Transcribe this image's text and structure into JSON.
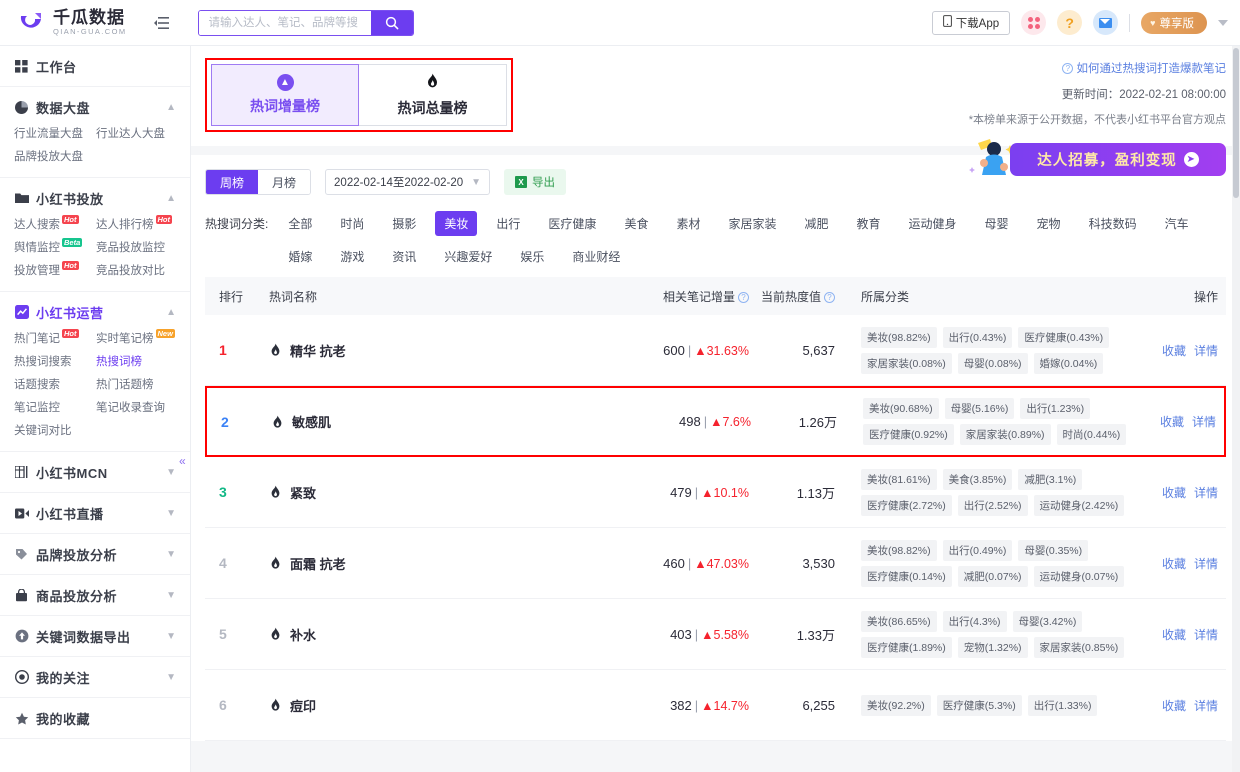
{
  "header": {
    "logo_cn": "千瓜数据",
    "logo_en": "QIAN-GUA.COM",
    "collapse_icon": "menu-fold-icon",
    "search": {
      "placeholder": "请输入达人、笔记、品牌等搜",
      "value": "",
      "button_icon": "search-icon"
    },
    "download_app": "下载App",
    "icons": {
      "apps": "apps-grid-icon",
      "help": "question-mark-icon",
      "message": "envelope-icon"
    },
    "vip_label": "尊享版",
    "user_caret": "caret-down-icon"
  },
  "sidebar": {
    "workbench": {
      "label": "工作台",
      "icon": "grid-icon"
    },
    "groups": [
      {
        "label": "数据大盘",
        "icon": "pie-chart-icon",
        "expanded": true,
        "active": false,
        "links": [
          {
            "label": "行业流量大盘",
            "badge": ""
          },
          {
            "label": "行业达人大盘",
            "badge": ""
          },
          {
            "label": "品牌投放大盘",
            "badge": ""
          }
        ]
      },
      {
        "label": "小红书投放",
        "icon": "folder-icon",
        "expanded": true,
        "active": false,
        "links": [
          {
            "label": "达人搜索",
            "badge": "Hot"
          },
          {
            "label": "达人排行榜",
            "badge": "Hot"
          },
          {
            "label": "舆情监控",
            "badge": "Beta"
          },
          {
            "label": "竞品投放监控",
            "badge": ""
          },
          {
            "label": "投放管理",
            "badge": "Hot"
          },
          {
            "label": "竞品投放对比",
            "badge": ""
          }
        ]
      },
      {
        "label": "小红书运营",
        "icon": "chart-line-icon",
        "expanded": true,
        "active": true,
        "links": [
          {
            "label": "热门笔记",
            "badge": "Hot"
          },
          {
            "label": "实时笔记榜",
            "badge": "New"
          },
          {
            "label": "热搜词搜索",
            "badge": ""
          },
          {
            "label": "热搜词榜",
            "badge": "",
            "current": true
          },
          {
            "label": "话题搜索",
            "badge": ""
          },
          {
            "label": "热门话题榜",
            "badge": ""
          },
          {
            "label": "笔记监控",
            "badge": ""
          },
          {
            "label": "笔记收录查询",
            "badge": ""
          },
          {
            "label": "关键词对比",
            "badge": ""
          }
        ]
      },
      {
        "label": "小红书MCN",
        "icon": "table-icon",
        "expanded": false,
        "links": []
      },
      {
        "label": "小红书直播",
        "icon": "video-icon",
        "expanded": false,
        "links": []
      },
      {
        "label": "品牌投放分析",
        "icon": "tag-icon",
        "expanded": false,
        "links": []
      },
      {
        "label": "商品投放分析",
        "icon": "bag-icon",
        "expanded": false,
        "links": []
      },
      {
        "label": "关键词数据导出",
        "icon": "upload-circle-icon",
        "expanded": false,
        "links": []
      },
      {
        "label": "我的关注",
        "icon": "eye-icon",
        "expanded": false,
        "links": []
      },
      {
        "label": "我的收藏",
        "icon": "star-icon",
        "expanded": false,
        "links": []
      }
    ],
    "collapse_handle": "«"
  },
  "main": {
    "tabs": [
      {
        "label": "热词增量榜",
        "icon": "arrow-up-circle-icon",
        "active": true
      },
      {
        "label": "热词总量榜",
        "icon": "flame-icon",
        "active": false
      }
    ],
    "help_link": "如何通过热搜词打造爆款笔记",
    "update_time": "更新时间：2022-02-21 08:00:00",
    "disclaimer": "*本榜单来源于公开数据，不代表小红书平台官方观点",
    "range_tabs": [
      {
        "label": "周榜",
        "active": true
      },
      {
        "label": "月榜",
        "active": false
      }
    ],
    "date_range": "2022-02-14至2022-02-20",
    "export_label": "导出",
    "promo_text": "达人招募，盈利变现",
    "category_label": "热搜词分类:",
    "categories": [
      {
        "label": "全部",
        "active": false
      },
      {
        "label": "时尚",
        "active": false
      },
      {
        "label": "摄影",
        "active": false
      },
      {
        "label": "美妆",
        "active": true
      },
      {
        "label": "出行",
        "active": false
      },
      {
        "label": "医疗健康",
        "active": false
      },
      {
        "label": "美食",
        "active": false
      },
      {
        "label": "素材",
        "active": false
      },
      {
        "label": "家居家装",
        "active": false
      },
      {
        "label": "减肥",
        "active": false
      },
      {
        "label": "教育",
        "active": false
      },
      {
        "label": "运动健身",
        "active": false
      },
      {
        "label": "母婴",
        "active": false
      },
      {
        "label": "宠物",
        "active": false
      },
      {
        "label": "科技数码",
        "active": false
      },
      {
        "label": "汽车",
        "active": false
      },
      {
        "label": "婚嫁",
        "active": false
      },
      {
        "label": "游戏",
        "active": false
      },
      {
        "label": "资讯",
        "active": false
      },
      {
        "label": "兴趣爱好",
        "active": false
      },
      {
        "label": "娱乐",
        "active": false
      },
      {
        "label": "商业财经",
        "active": false
      }
    ],
    "table": {
      "columns": {
        "rank": "排行",
        "name": "热词名称",
        "increase": "相关笔记增量",
        "heat": "当前热度值",
        "cats": "所属分类",
        "op": "操作"
      },
      "actions": {
        "favorite": "收藏",
        "detail": "详情"
      },
      "rows": [
        {
          "rank": "1",
          "keyword": "精华 抗老",
          "increase": "600",
          "change": "31.63%",
          "heat": "5,637",
          "cats": [
            "美妆(98.82%)",
            "出行(0.43%)",
            "医疗健康(0.43%)",
            "家居家装(0.08%)",
            "母婴(0.08%)",
            "婚嫁(0.04%)"
          ],
          "highlight": false
        },
        {
          "rank": "2",
          "keyword": "敏感肌",
          "increase": "498",
          "change": "7.6%",
          "heat": "1.26万",
          "cats": [
            "美妆(90.68%)",
            "母婴(5.16%)",
            "出行(1.23%)",
            "医疗健康(0.92%)",
            "家居家装(0.89%)",
            "时尚(0.44%)"
          ],
          "highlight": true
        },
        {
          "rank": "3",
          "keyword": "紧致",
          "increase": "479",
          "change": "10.1%",
          "heat": "1.13万",
          "cats": [
            "美妆(81.61%)",
            "美食(3.85%)",
            "减肥(3.1%)",
            "医疗健康(2.72%)",
            "出行(2.52%)",
            "运动健身(2.42%)"
          ],
          "highlight": false
        },
        {
          "rank": "4",
          "keyword": "面霜 抗老",
          "increase": "460",
          "change": "47.03%",
          "heat": "3,530",
          "cats": [
            "美妆(98.82%)",
            "出行(0.49%)",
            "母婴(0.35%)",
            "医疗健康(0.14%)",
            "减肥(0.07%)",
            "运动健身(0.07%)"
          ],
          "highlight": false
        },
        {
          "rank": "5",
          "keyword": "补水",
          "increase": "403",
          "change": "5.58%",
          "heat": "1.33万",
          "cats": [
            "美妆(86.65%)",
            "出行(4.3%)",
            "母婴(3.42%)",
            "医疗健康(1.89%)",
            "宠物(1.32%)",
            "家居家装(0.85%)"
          ],
          "highlight": false
        },
        {
          "rank": "6",
          "keyword": "痘印",
          "increase": "382",
          "change": "14.7%",
          "heat": "6,255",
          "cats": [
            "美妆(92.2%)",
            "医疗健康(5.3%)",
            "出行(1.33%)"
          ],
          "highlight": false
        }
      ]
    }
  },
  "colors": {
    "brand_purple": "#6c3df0",
    "rank1_red": "#f5222d",
    "rank2_blue": "#3b82f6",
    "rank3_green": "#12b886",
    "up_red": "#f5222d",
    "link_blue": "#5a7fe0",
    "highlight_box": "#ff0000"
  }
}
